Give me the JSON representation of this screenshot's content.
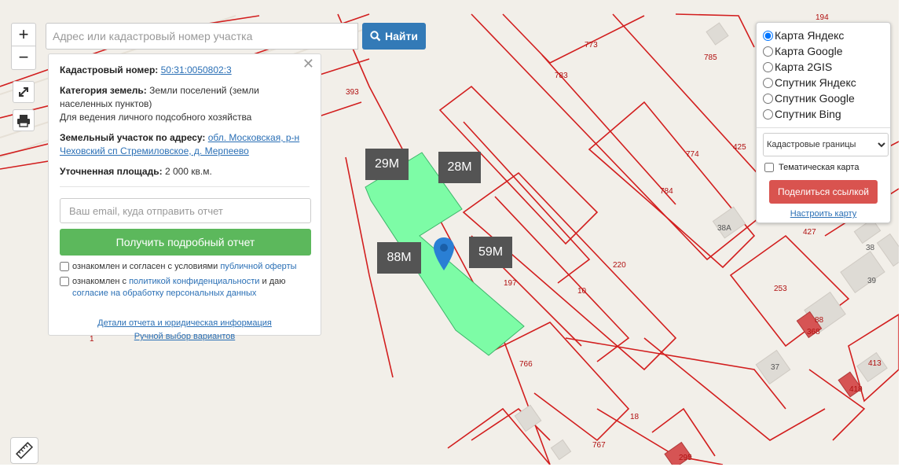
{
  "map": {
    "parcel_labels": [
      "194",
      "773",
      "785",
      "783",
      "393",
      "774",
      "425",
      "784",
      "38А",
      "220",
      "427",
      "38",
      "253",
      "197",
      "10",
      "39",
      "766",
      "88",
      "368",
      "37",
      "413",
      "1",
      "418",
      "18",
      "767",
      "295"
    ],
    "highlight_color": "#7dfca6",
    "boundary_color": "#d21e1e"
  },
  "zoom": {
    "in_label": "+",
    "out_label": "−"
  },
  "tools": {
    "fullscreen_icon": "expand-icon",
    "print_icon": "print-icon",
    "ruler_icon": "ruler-icon"
  },
  "search": {
    "placeholder": "Адрес или кадастровый номер участка",
    "button_label": "Найти"
  },
  "info": {
    "cadastral_label": "Кадастровый номер:",
    "cadastral_value": "50:31:0050802:3",
    "category_label": "Категория земель:",
    "category_value": "Земли поселений (земли населенных пунктов)",
    "usage": "Для ведения личного подсобного хозяйства",
    "address_label": "Земельный участок по адресу:",
    "address_value": "обл. Московская, р-н Чеховский сп Стремиловское, д. Мерпеево",
    "area_label": "Уточненная площадь:",
    "area_value": "2 000 кв.м.",
    "email_placeholder": "Ваш email, куда отправить отчет",
    "report_button": "Получить подробный отчет",
    "consent1_text": "ознакомлен и согласен с условиями",
    "consent1_link": "публичной оферты",
    "consent2_text": "ознакомлен с",
    "consent2_link1": "политикой конфиденциальности",
    "consent2_mid": "и даю",
    "consent2_link2": "согласие на обработку персональных данных",
    "details_link": "Детали отчета и юридическая информация",
    "manual_link": "Ручной выбор вариантов"
  },
  "layers": {
    "options": [
      "Карта Яндекс",
      "Карта Google",
      "Карта 2GIS",
      "Спутник Яндекс",
      "Спутник Google",
      "Спутник Bing"
    ],
    "selected": "Карта Яндекс",
    "select_value": "Кадастровые границы",
    "thematic_label": "Тематическая карта",
    "share_button": "Поделиться ссылкой",
    "config_link": "Настроить карту"
  },
  "dimensions": [
    "29M",
    "28M",
    "88M",
    "59M"
  ]
}
